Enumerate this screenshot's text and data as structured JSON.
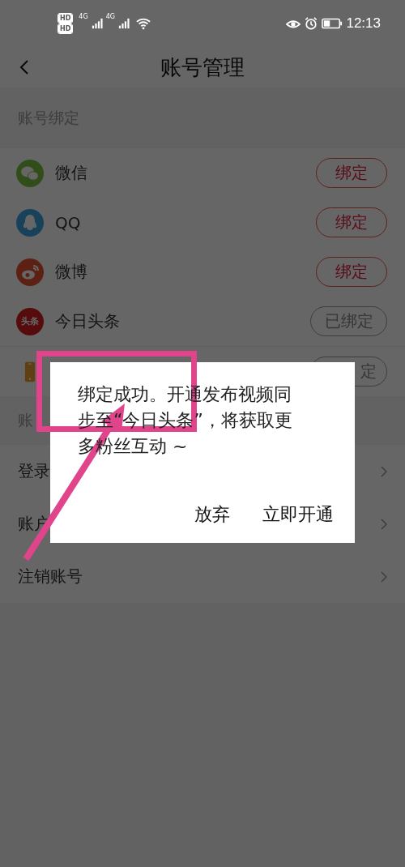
{
  "status_bar": {
    "sim_labels": [
      "HD",
      "HD"
    ],
    "network_labels": [
      "4G",
      "4G"
    ],
    "time": "12:13"
  },
  "nav": {
    "title": "账号管理"
  },
  "binding_section": {
    "header": "账号绑定",
    "rows": [
      {
        "kind": "wechat",
        "name": "微信",
        "button": "绑定",
        "bound": false
      },
      {
        "kind": "qq",
        "name": "QQ",
        "button": "绑定",
        "bound": false
      },
      {
        "kind": "weibo",
        "name": "微博",
        "button": "绑定",
        "bound": false
      },
      {
        "kind": "toutiao",
        "icon_text": "头条",
        "name": "今日头条",
        "button": "已绑定",
        "bound": true
      },
      {
        "kind": "phone",
        "button": "定",
        "bound": true
      }
    ]
  },
  "security_section": {
    "header": "账",
    "rows": [
      {
        "label": "登录"
      },
      {
        "label": "账户"
      },
      {
        "label": "注销账号"
      }
    ]
  },
  "dialog": {
    "message": "绑定成功。开通发布视频同步至“今日头条”，将获取更多粉丝互动 ~",
    "buttons": [
      "放弃",
      "立即开通"
    ]
  }
}
